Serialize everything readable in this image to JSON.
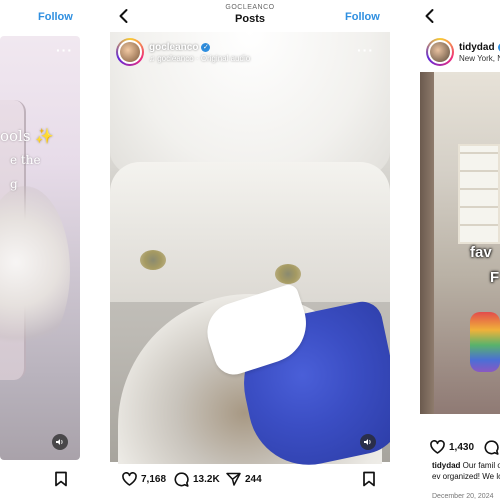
{
  "panel_left": {
    "follow_label": "Follow",
    "caption_line1": "ools ✨",
    "caption_line2": "e the",
    "caption_line3": "g",
    "sound_icon": "speaker-icon",
    "save_icon": "bookmark-icon"
  },
  "panel_center": {
    "header_small": "GOCLEANCO",
    "header_title": "Posts",
    "follow_label": "Follow",
    "back_icon": "chevron-left-icon",
    "username": "gocleanco",
    "audio_text": "gocleanco · Original audio",
    "more_icon": "more-dots-icon",
    "actions": {
      "likes": "7,168",
      "comments": "13.2K",
      "shares": "244"
    },
    "sound_icon": "speaker-icon",
    "save_icon": "bookmark-icon"
  },
  "panel_right": {
    "back_icon": "chevron-left-icon",
    "username": "tidydad",
    "location": "New York, N",
    "sticker_line1": "fav",
    "sticker_line2": "F",
    "likes": "1,430",
    "caption_user": "tidydad",
    "caption_text": " Our famil our space is an ev organized! We lov",
    "date": "December 20, 2024"
  },
  "colors": {
    "accent": "#2f8fe0",
    "verified": "#2f8fe0"
  }
}
